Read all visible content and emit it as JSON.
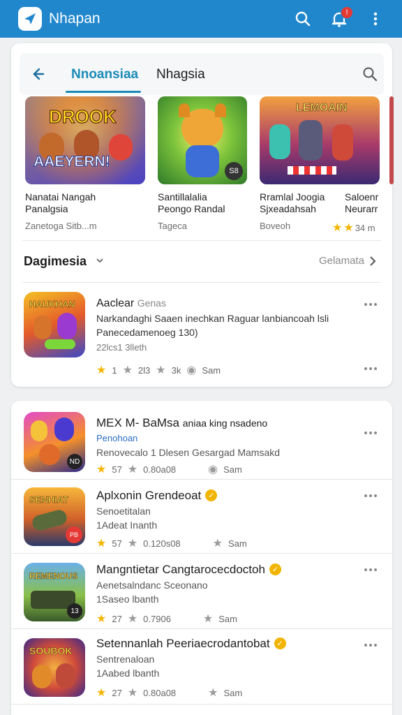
{
  "appbar": {
    "title": "Nhapan",
    "badge": "!"
  },
  "tabs": {
    "active": "Nnoansiaa",
    "second": "Nhagsia"
  },
  "featured": [
    {
      "art_text": "DROOK",
      "art_text2": "AAEYERN!",
      "line1": "Nanatai Nangah",
      "line2": "Panalgsia",
      "meta": "Zanetoga Sitb...m"
    },
    {
      "art_badge": "S8",
      "line1": "Santillalalia",
      "line2": "Peongo Randal",
      "meta": "Tageca"
    },
    {
      "art_text": "LEMOAIN",
      "line1": "Rramlal Joogia",
      "line2": "Sjxeadahsah",
      "meta": "Boveoh"
    },
    {
      "line1": "Saloenr",
      "line2": "Neurarr",
      "meta": "34 m"
    }
  ],
  "section": {
    "title": "Dagimesia",
    "see_all": "Gelamata"
  },
  "apps": [
    {
      "title": "Aaclear",
      "title_extra": "Genas",
      "sub1": "Narkandaghi Saaen inechkan Raguar lanbiancoah lsli",
      "sub2": "Panecedamenoeg 130)",
      "sub3": "22lcs1 3lleth",
      "rating": "1",
      "meta_a": "2l3",
      "meta_b": "3k",
      "meta_c": "Sam"
    },
    {
      "title": "MEX M- BaMsa",
      "title_extra": "aniaa king nsadeno",
      "sub1": "Penohoan",
      "sub2": "Renovecalo 1 Dlesen Gesargad Mamsakd",
      "rating": "57",
      "meta_a": "0.80a08",
      "meta_c": "Sam",
      "icon_badge": "ND"
    },
    {
      "title": "Aplxonin Grendeoat",
      "sub1": "Senoetitalan",
      "sub2": "1Adeat Inanth",
      "rating": "57",
      "meta_a": "0.120s08",
      "meta_c": "Sam",
      "icon_badge": "PB"
    },
    {
      "title": "Mangntietar Cangtarocecdoctoh",
      "sub1": "Aenetsalndanc Sceonano",
      "sub2": "1Saseo lbanth",
      "rating": "27",
      "meta_a": "0.7906",
      "meta_c": "Sam",
      "icon_badge": "13"
    },
    {
      "title": "Setennanlah Peeriaecrodantobat",
      "sub1": "Sentrenaloan",
      "sub2": "1Aabed lbanth",
      "rating": "27",
      "meta_a": "0.80a08",
      "meta_c": "Sam"
    }
  ],
  "colors": {
    "appbar": "#2187cd",
    "accent": "#1a8bb8",
    "star": "#f5b400",
    "verified": "#f1b500"
  }
}
